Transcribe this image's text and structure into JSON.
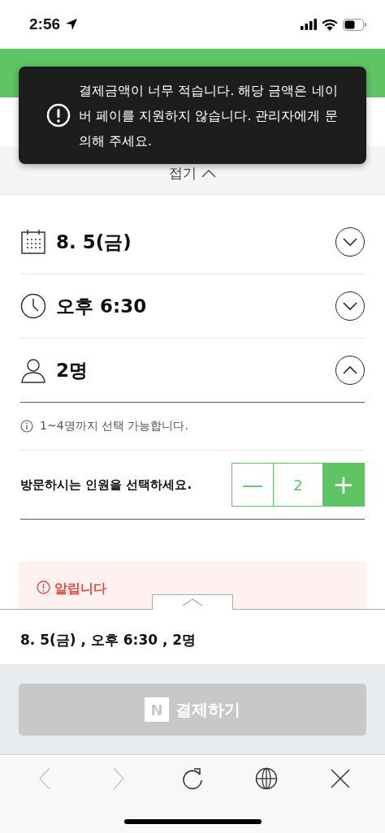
{
  "status_bar": {
    "time": "2:56"
  },
  "collapse": {
    "label": "접기"
  },
  "toast": {
    "message": "결제금액이 너무 적습니다. 해당 금액은 네이버 페이를 지원하지 않습니다. 관리자에게 문의해 주세요."
  },
  "options": [
    {
      "kind": "date",
      "value": "8. 5(금)",
      "expanded": false
    },
    {
      "kind": "time",
      "value": "오후 6:30",
      "expanded": false
    },
    {
      "kind": "people",
      "value": "2명",
      "expanded": true
    }
  ],
  "info": "1~4명까지 선택 가능합니다.",
  "stepper": {
    "label": "방문하시는 인원을 선택하세요.",
    "minus": "—",
    "value": "2",
    "plus": "+"
  },
  "notice": {
    "title": "알립니다"
  },
  "summary": "8. 5(금) , 오후 6:30 , 2명",
  "pay_button": {
    "logo": "N",
    "label": "결제하기",
    "disabled": true
  },
  "browser": {
    "back_disabled": true,
    "forward_disabled": true
  }
}
